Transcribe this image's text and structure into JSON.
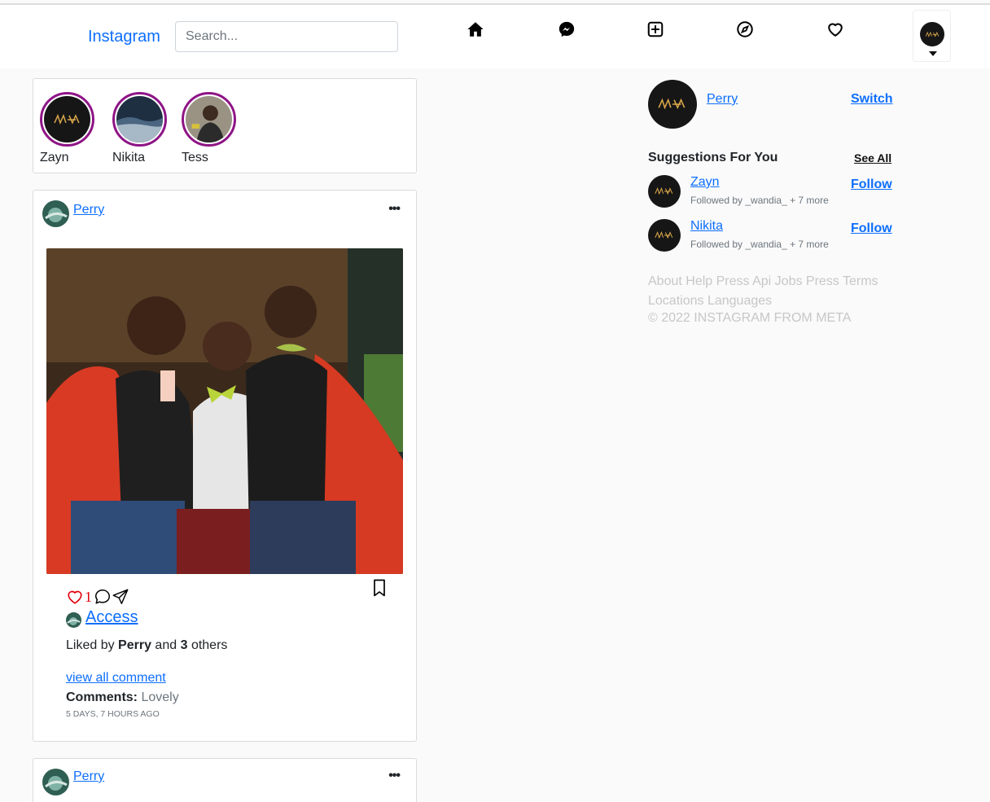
{
  "header": {
    "brand": "Instagram",
    "search_placeholder": "Search...",
    "icons": [
      "home-icon",
      "messenger-icon",
      "add-post-icon",
      "explore-icon",
      "heart-icon"
    ]
  },
  "stories": [
    {
      "name": "Zayn"
    },
    {
      "name": "Nikita"
    },
    {
      "name": "Tess"
    }
  ],
  "post": {
    "username": "Perry",
    "like_count": "1",
    "caption_link": "Access",
    "liked_by_prefix": "Liked by",
    "liked_by_user": "Perry",
    "liked_by_and": "and",
    "liked_by_count": "3",
    "liked_by_suffix": "others",
    "view_all": "view all comment",
    "comments_label": "Comments:",
    "comment_text": "Lovely",
    "time": "5 DAYS, 7 HOURS AGO"
  },
  "post2": {
    "username": "Perry"
  },
  "sidebar": {
    "username": "Perry",
    "switch_label": "Switch",
    "suggestions_title": "Suggestions For You",
    "see_all": "See All",
    "suggestions": [
      {
        "name": "Zayn",
        "sub": "Followed by _wandia_ + 7 more",
        "action": "Follow"
      },
      {
        "name": "Nikita",
        "sub": "Followed by _wandia_ + 7 more",
        "action": "Follow"
      }
    ],
    "footer_links": [
      "About",
      "Help",
      "Press",
      "Api",
      "Jobs",
      "Press",
      "Terms",
      "Locations",
      "Languages"
    ],
    "copyright": "© 2022 INSTAGRAM FROM META"
  },
  "colors": {
    "link": "#0d6efd",
    "story_ring": "#8e1486",
    "like": "#e0000b",
    "footer_text": "#c7c7c7"
  }
}
